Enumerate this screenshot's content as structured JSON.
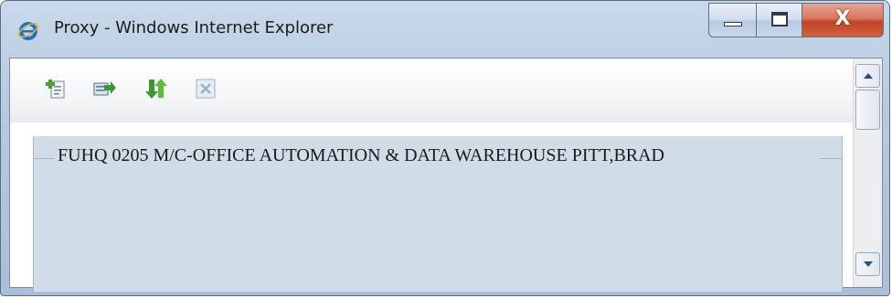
{
  "window": {
    "title": "Proxy - Windows Internet Explorer",
    "app_icon": "internet-explorer-icon",
    "controls": {
      "minimize_icon": "minimize-icon",
      "maximize_icon": "maximize-icon",
      "close_glyph": "X"
    }
  },
  "toolbar": {
    "buttons": [
      {
        "name": "add-document-icon"
      },
      {
        "name": "export-icon"
      },
      {
        "name": "refresh-icon"
      },
      {
        "name": "close-icon"
      }
    ]
  },
  "fieldset": {
    "legend": "FUHQ 0205 M/C-OFFICE AUTOMATION & DATA WAREHOUSE PITT,BRAD"
  },
  "colors": {
    "titlebar": "#b7c9df",
    "close_button": "#c34328",
    "fieldset_background": "#d0dce8"
  }
}
